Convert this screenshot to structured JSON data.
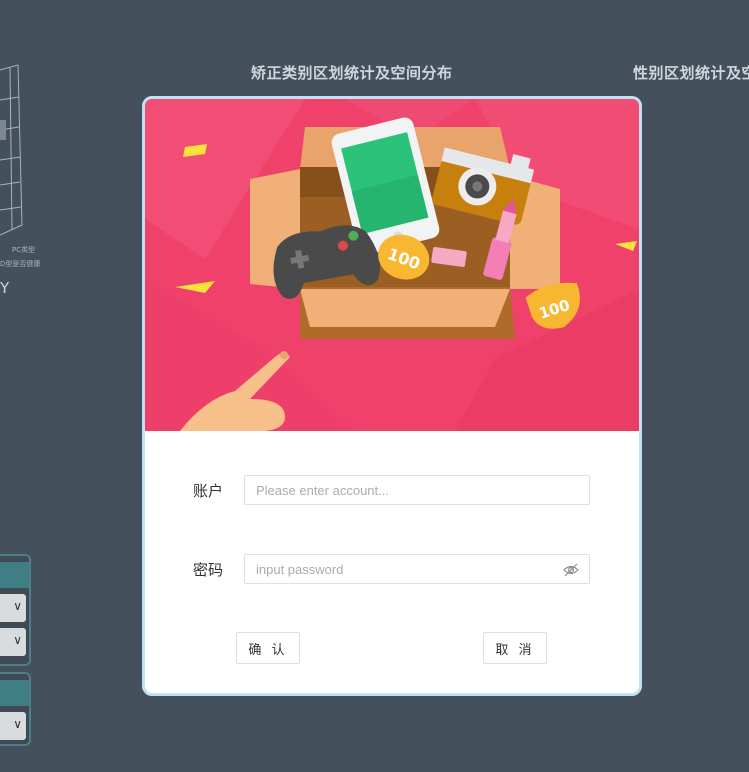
{
  "background": {
    "titles": [
      "矫正类别区划统计及空间分布",
      "性别区划统计及空"
    ],
    "left_figure_labels": [
      "PC类型",
      "D型是否健康",
      "Y"
    ]
  },
  "login_dialog": {
    "banner": {
      "tag_text_1": "100",
      "tag_text_2": "100"
    },
    "account": {
      "label": "账户",
      "placeholder": "Please enter account...",
      "value": ""
    },
    "password": {
      "label": "密码",
      "placeholder": "input password",
      "value": "",
      "toggle_icon": "eye-off-icon"
    },
    "confirm_label": "确 认",
    "cancel_label": "取 消"
  },
  "colors": {
    "page_background": "#44505c",
    "banner_pink": "#f0416a",
    "dialog_border": "#bfe1f1"
  }
}
